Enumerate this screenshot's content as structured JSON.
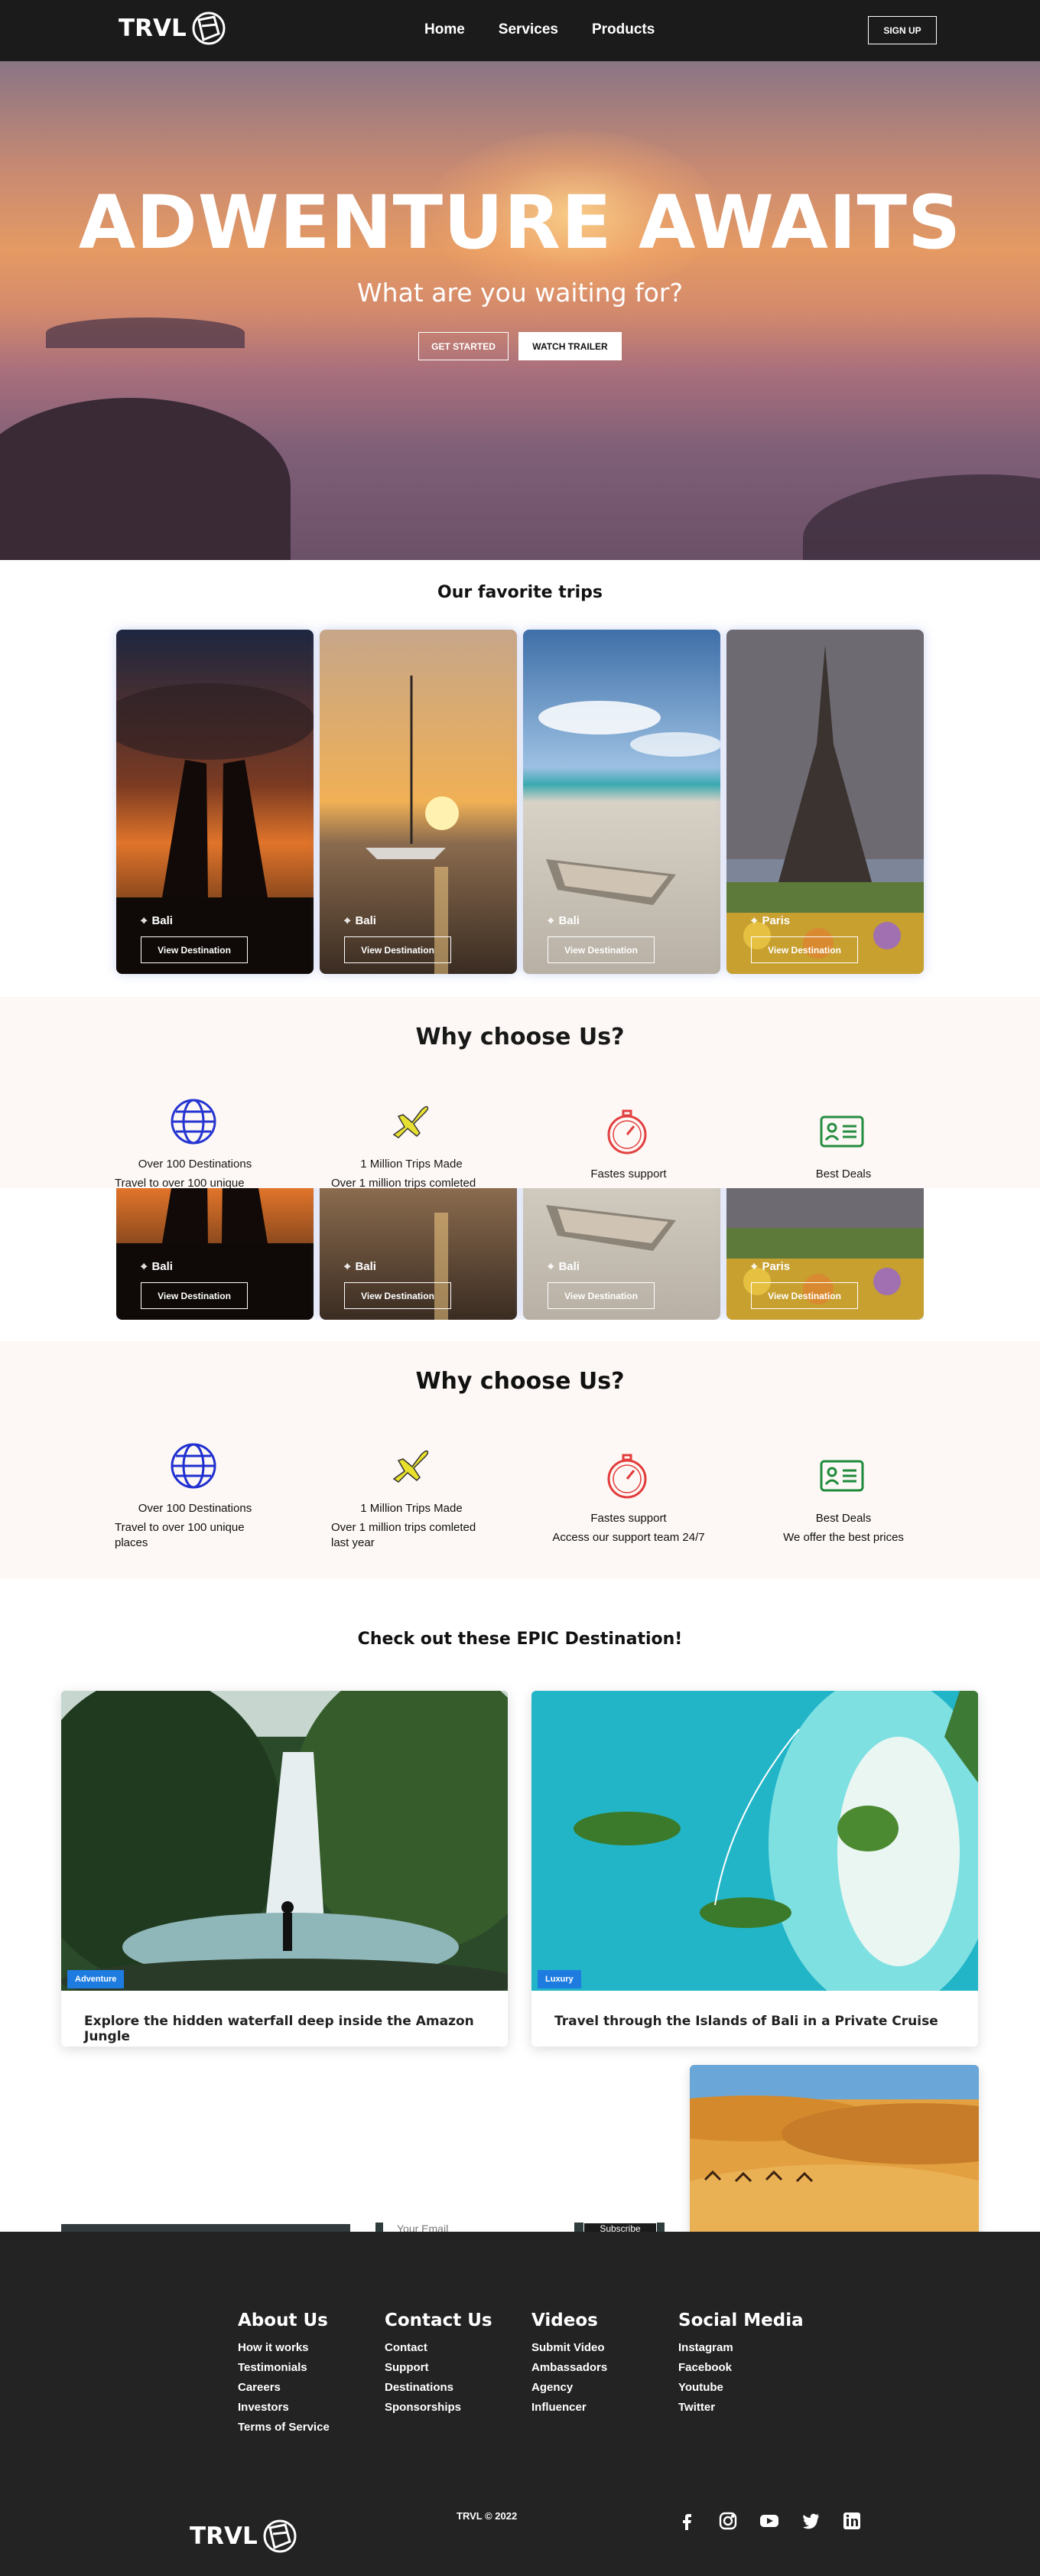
{
  "nav": {
    "brand": "TRVL",
    "links": [
      "Home",
      "Services",
      "Products"
    ],
    "signup": "SIGN UP"
  },
  "hero": {
    "title": "ADWENTURE AWAITS",
    "subtitle": "What are you waiting for?",
    "btn_start": "GET STARTED",
    "btn_trailer": "WATCH TRAILER"
  },
  "favorites": {
    "title": "Our favorite trips",
    "cards": [
      {
        "location": "Bali",
        "button": "View Destination"
      },
      {
        "location": "Bali",
        "button": "View Destination"
      },
      {
        "location": "Bali",
        "button": "View Destination"
      },
      {
        "location": "Paris",
        "button": "View Destination"
      }
    ]
  },
  "why": {
    "title": "Why choose Us?",
    "features": [
      {
        "title": "Over 100 Destinations",
        "desc": "Travel to over 100 unique places",
        "icon": "globe-icon"
      },
      {
        "title": "1 Million Trips Made",
        "desc": "Over 1 million trips comleted last year",
        "icon": "airplane-icon"
      },
      {
        "title": "Fastes support",
        "desc": "Access our support team 24/7",
        "icon": "stopwatch-icon"
      },
      {
        "title": "Best Deals",
        "desc": "We offer the best prices",
        "icon": "id-card-icon"
      }
    ],
    "ghost_desc": [
      "Travel to over 100 unique",
      "Over 1 million trips comleted"
    ]
  },
  "epic": {
    "title": "Check out these EPIC Destination!",
    "cards": [
      {
        "tag": "Adventure",
        "title": "Explore the hidden waterfall deep inside the Amazon Jungle"
      },
      {
        "tag": "Luxury",
        "title": "Travel through the Islands of Bali in a Private Cruise"
      }
    ]
  },
  "subscribe": {
    "placeholder": "Your Email",
    "button": "Subscribe"
  },
  "footer": {
    "columns": [
      {
        "heading": "About Us",
        "links": [
          "How it works",
          "Testimonials",
          "Careers",
          "Investors",
          "Terms of Service"
        ]
      },
      {
        "heading": "Contact Us",
        "links": [
          "Contact",
          "Support",
          "Destinations",
          "Sponsorships"
        ]
      },
      {
        "heading": "Videos",
        "links": [
          "Submit Video",
          "Ambassadors",
          "Agency",
          "Influencer"
        ]
      },
      {
        "heading": "Social Media",
        "links": [
          "Instagram",
          "Facebook",
          "Youtube",
          "Twitter"
        ]
      }
    ],
    "brand": "TRVL",
    "copyright": "TRVL © 2022",
    "social_icons": [
      "facebook-icon",
      "instagram-icon",
      "youtube-icon",
      "twitter-icon",
      "linkedin-icon"
    ]
  },
  "colors": {
    "nav_bg": "#1b1b1b",
    "footer_bg": "#232323",
    "why_bg": "#fdf8f5",
    "tag_blue": "#1e7ce0",
    "globe_blue": "#1f2fd0",
    "plane_yellow": "#e8e02a",
    "watch_red": "#e23b3b",
    "card_green": "#1e8a3a"
  }
}
